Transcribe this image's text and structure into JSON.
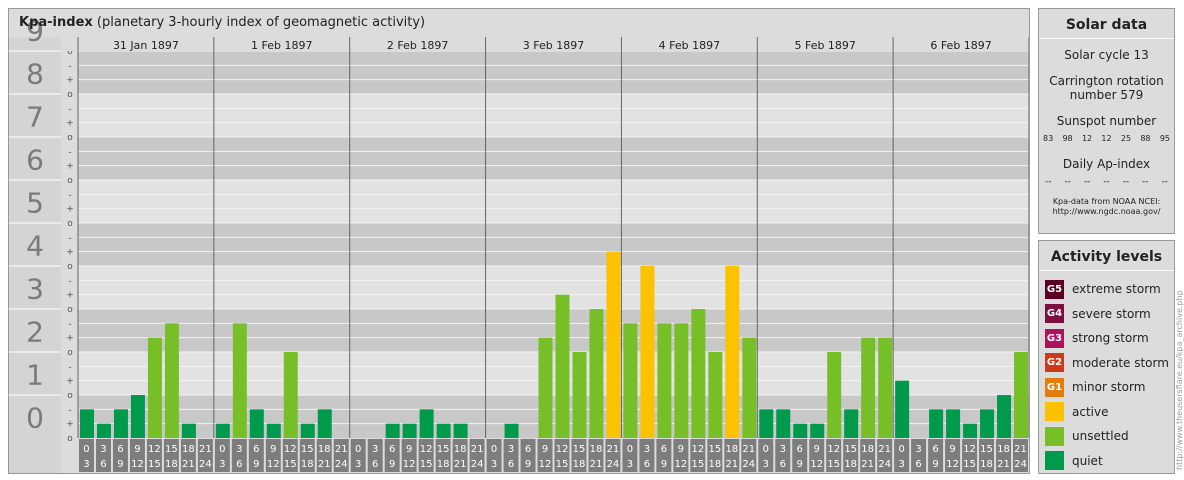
{
  "header": {
    "title": "Kpa-index",
    "subtitle": "(planetary 3-hourly index of geomagnetic activity)"
  },
  "chart_data": {
    "type": "bar",
    "title": "Kpa-index",
    "subtitle": "(planetary 3-hourly index of geomagnetic activity)",
    "ylim": [
      0,
      9
    ],
    "y_major_ticks": [
      "0",
      "1",
      "2",
      "3",
      "4",
      "5",
      "6",
      "7",
      "8",
      "9"
    ],
    "y_minor_ticks": [
      "-",
      "o",
      "+"
    ],
    "days": [
      "31 Jan 1897",
      "1 Feb 1897",
      "2 Feb 1897",
      "3 Feb 1897",
      "4 Feb 1897",
      "5 Feb 1897",
      "6 Feb 1897"
    ],
    "interval_start_labels": [
      "0",
      "3",
      "6",
      "9",
      "12",
      "15",
      "18",
      "21"
    ],
    "interval_end_labels": [
      "3",
      "6",
      "9",
      "12",
      "15",
      "18",
      "21",
      "24"
    ],
    "values": [
      0.667,
      0.333,
      0.667,
      1.0,
      2.333,
      2.667,
      0.333,
      0,
      0.333,
      2.667,
      0.667,
      0.333,
      2.0,
      0.333,
      0.667,
      0,
      0,
      0,
      0.333,
      0.333,
      0.667,
      0.333,
      0.333,
      0,
      0,
      0.333,
      0,
      2.333,
      3.333,
      2.0,
      3.0,
      4.333,
      2.667,
      4.0,
      2.667,
      2.667,
      3.0,
      2.0,
      4.0,
      2.333,
      0.667,
      0.667,
      0.333,
      0.333,
      2.0,
      0.667,
      2.333,
      2.333,
      1.333,
      0,
      0.667,
      0.667,
      0.333,
      0.667,
      1.0,
      2.0
    ],
    "level_colors": {
      "quiet": "#009a4d",
      "unsettled": "#76bf26",
      "active": "#fcc200"
    }
  },
  "solar": {
    "title": "Solar data",
    "cycle": "Solar cycle 13",
    "carrington_line1": "Carrington rotation",
    "carrington_line2": "number 579",
    "sunspot_title": "Sunspot number",
    "sunspots": [
      "83",
      "98",
      "12",
      "12",
      "25",
      "88",
      "95"
    ],
    "ap_title": "Daily Ap-index",
    "ap_values": [
      "--",
      "--",
      "--",
      "--",
      "--",
      "--",
      "--"
    ],
    "source_line1": "Kpa-data from NOAA NCEI:",
    "source_line2": "http://www.ngdc.noaa.gov/"
  },
  "levels": {
    "title": "Activity levels",
    "items": [
      {
        "code": "G5",
        "label": "extreme storm",
        "color": "#5a0024"
      },
      {
        "code": "G4",
        "label": "severe storm",
        "color": "#7b0f3f"
      },
      {
        "code": "G3",
        "label": "strong storm",
        "color": "#b0115c"
      },
      {
        "code": "G2",
        "label": "moderate storm",
        "color": "#cc3a1a"
      },
      {
        "code": "G1",
        "label": "minor storm",
        "color": "#e27d0e"
      },
      {
        "code": "",
        "label": "active",
        "color": "#fcc200"
      },
      {
        "code": "",
        "label": "unsettled",
        "color": "#76bf26"
      },
      {
        "code": "",
        "label": "quiet",
        "color": "#009a4d"
      }
    ]
  },
  "watermark": "http://www.theusersflare.eu/kpa_archive.php"
}
